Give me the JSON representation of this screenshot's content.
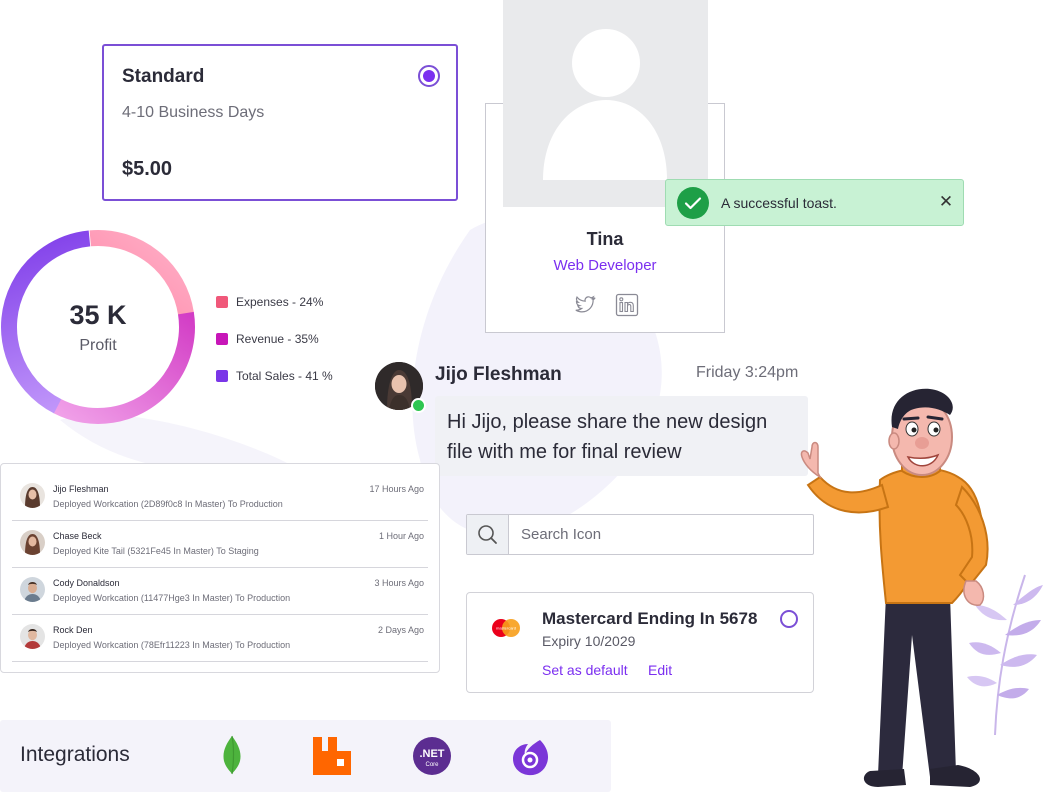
{
  "shipping": {
    "title": "Standard",
    "delivery": "4-10 Business Days",
    "price": "$5.00"
  },
  "donut": {
    "value": "35 K",
    "label": "Profit",
    "legend": [
      {
        "label": "Expenses - 24%",
        "color": "#f0587a"
      },
      {
        "label": "Revenue - 35%",
        "color": "#c716b8"
      },
      {
        "label": "Total Sales - 41 %",
        "color": "#7a36e8"
      }
    ]
  },
  "profile": {
    "name": "Tina",
    "role": "Web Developer"
  },
  "toast": {
    "message": "A successful toast.",
    "close_label": "✕"
  },
  "chat": {
    "name": "Jijo Fleshman",
    "time": "Friday 3:24pm",
    "message": "Hi Jijo, please share the new design file with me for final review"
  },
  "activity": [
    {
      "name": "Jijo Fleshman",
      "desc": "Deployed Workcation (2D89f0c8 In Master) To Production",
      "time": "17 Hours Ago"
    },
    {
      "name": "Chase Beck",
      "desc": "Deployed Kite Tail (5321Fe45 In Master) To Staging",
      "time": "1 Hour Ago"
    },
    {
      "name": "Cody Donaldson",
      "desc": "Deployed Workcation (11477Hge3 In Master) To Production",
      "time": "3 Hours Ago"
    },
    {
      "name": "Rock Den",
      "desc": "Deployed Workcation (78Efr11223 In Master) To Production",
      "time": "2 Days Ago"
    }
  ],
  "search": {
    "placeholder": "Search Icon"
  },
  "payment": {
    "brand_text": "mastercard",
    "title": "Mastercard Ending In 5678",
    "expiry": "Expiry 10/2029",
    "set_default": "Set as default",
    "edit": "Edit"
  },
  "integrations": {
    "title": "Integrations",
    "net_label": ".NET",
    "net_sub": "Core",
    "logos": [
      "mongodb-icon",
      "rabbitmq-icon",
      "dotnet-core-icon",
      "blazor-icon"
    ]
  }
}
